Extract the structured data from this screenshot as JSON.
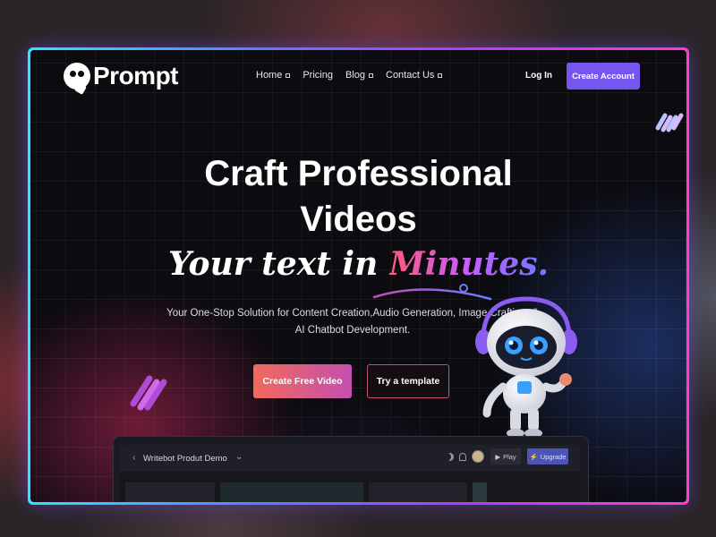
{
  "brand": {
    "name": "Prompt"
  },
  "nav": {
    "items": [
      {
        "label": "Home"
      },
      {
        "label": "Pricing"
      },
      {
        "label": "Blog"
      },
      {
        "label": "Contact Us"
      }
    ],
    "login_label": "Log In",
    "create_account_label": "Create Account"
  },
  "hero": {
    "title_line1": "Craft Professional",
    "title_line2": "Videos",
    "script_prefix": "Your text in ",
    "script_accent": "Minutes.",
    "description": "Your One-Stop Solution for Content Creation,Audio Generation, Image Crafting, & AI Chatbot Development.",
    "primary_button": "Create Free Video",
    "secondary_button": "Try a template"
  },
  "demo": {
    "back_glyph": "‹",
    "title": "Writebot Produt Demo",
    "chevron_glyph": "⌄",
    "play_label": "Play",
    "upgrade_label": "Upgrade"
  },
  "colors": {
    "accent": "#7655f0",
    "frame_gradient_start": "#2ee6ff",
    "frame_gradient_end": "#ff3ccf",
    "primary_button_start": "#f06a5a",
    "primary_button_end": "#c44fb0"
  }
}
